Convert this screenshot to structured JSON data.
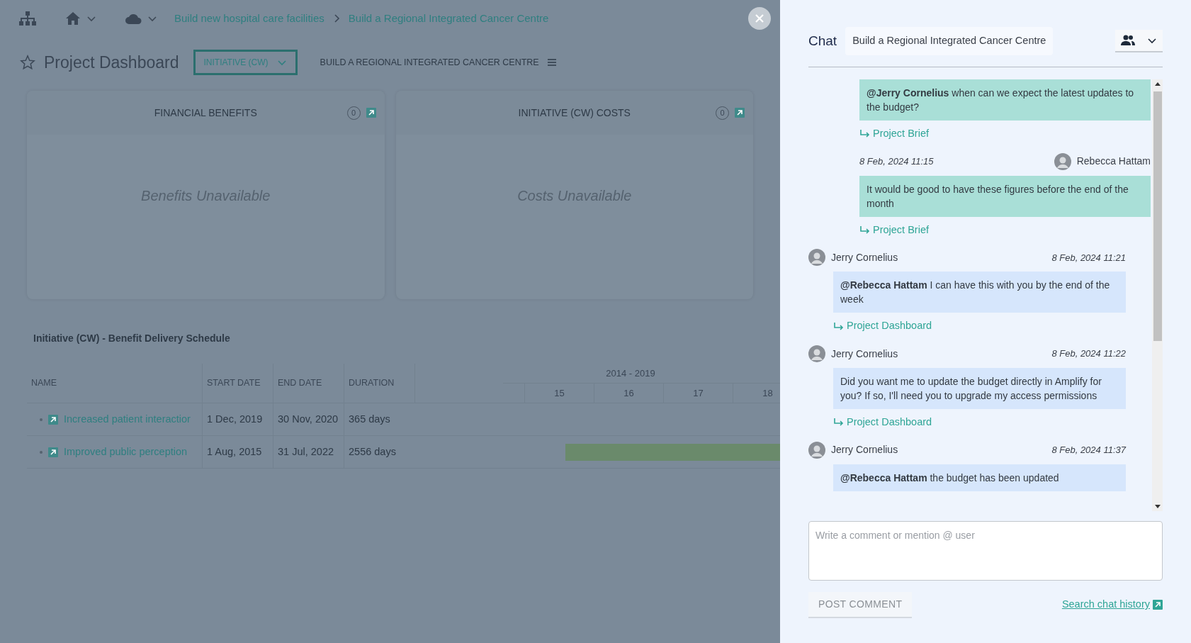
{
  "breadcrumb": [
    "Build new hospital care facilities",
    "Build a Regional Integrated Cancer Centre"
  ],
  "page": {
    "title": "Project Dashboard",
    "view_select": "INITIATIVE (CW)",
    "context": "BUILD A REGIONAL INTEGRATED CANCER CENTRE"
  },
  "cards": [
    {
      "title": "FINANCIAL BENEFITS",
      "count": "0",
      "empty": "Benefits Unavailable"
    },
    {
      "title": "INITIATIVE (CW) COSTS",
      "count": "0",
      "empty": "Costs Unavailable"
    }
  ],
  "schedule": {
    "title": "Initiative (CW) - Benefit Delivery Schedule",
    "columns": [
      "NAME",
      "START DATE",
      "END DATE",
      "DURATION"
    ],
    "period": "2014 - 2019",
    "ticks": [
      "15",
      "16",
      "17",
      "18"
    ],
    "rows": [
      {
        "name": "Increased patient interactior",
        "start": "1 Dec, 2019",
        "end": "30 Nov, 2020",
        "duration": "365 days",
        "bar": false
      },
      {
        "name": "Improved public perception",
        "start": "1 Aug, 2015",
        "end": "31 Jul, 2022",
        "duration": "2556 days",
        "bar": true
      }
    ]
  },
  "chat": {
    "title": "Chat",
    "topic": "Build a Regional Integrated Cancer Centre",
    "messages": [
      {
        "kind": "sent",
        "text": "**@Jerry Cornelius** when can we expect the latest updates to the budget?",
        "link": "Project Brief"
      },
      {
        "kind": "sent",
        "author": "Rebecca Hattam",
        "time": "8 Feb, 2024 11:15",
        "text": "It would be good to have these figures before the end of the month",
        "link": "Project Brief"
      },
      {
        "kind": "received",
        "author": "Jerry Cornelius",
        "time": "8 Feb, 2024 11:21",
        "text": "**@Rebecca Hattam** I can have this with you by the end of the week",
        "link": "Project Dashboard"
      },
      {
        "kind": "received",
        "author": "Jerry Cornelius",
        "time": "8 Feb, 2024 11:22",
        "text": "Did you want me to update the budget directly in Amplify for you? If so, I'll need you to upgrade my access permissions",
        "link": "Project Dashboard"
      },
      {
        "kind": "received",
        "author": "Jerry Cornelius",
        "time": "8 Feb, 2024 11:37",
        "text": "**@Rebecca Hattam** the budget has been updated"
      }
    ],
    "placeholder": "Write a comment or mention @ user",
    "post_button": "POST COMMENT",
    "history_link": "Search chat history"
  }
}
